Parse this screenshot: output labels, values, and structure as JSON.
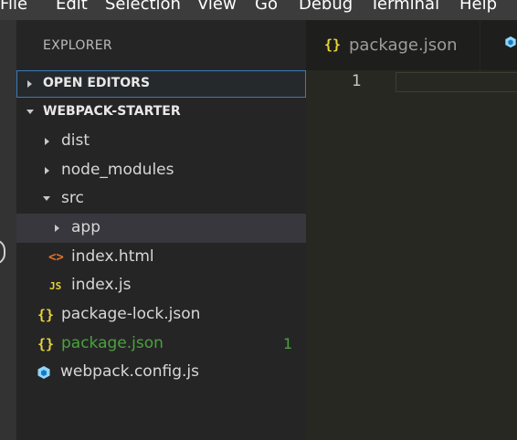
{
  "menu": [
    "File",
    "Edit",
    "Selection",
    "View",
    "Go",
    "Debug",
    "Terminal",
    "Help"
  ],
  "sidebar": {
    "title": "EXPLORER",
    "open_editors": "OPEN EDITORS",
    "project": "WEBPACK-STARTER"
  },
  "tree": {
    "dist": "dist",
    "node_modules": "node_modules",
    "src": "src",
    "app": "app",
    "index_html": "index.html",
    "index_js": "index.js",
    "package_lock": "package-lock.json",
    "package_json": "package.json",
    "package_json_badge": "1",
    "webpack_config": "webpack.config.js"
  },
  "icons": {
    "json": "{}",
    "html": "<>",
    "js": "JS"
  },
  "colors": {
    "modified": "#4ca13e",
    "json_icon": "#e6d33a",
    "html_icon": "#e0742e",
    "webpack_icon": "#8ed6fb"
  },
  "editor": {
    "tab_label": "package.json",
    "line_number": "1"
  }
}
